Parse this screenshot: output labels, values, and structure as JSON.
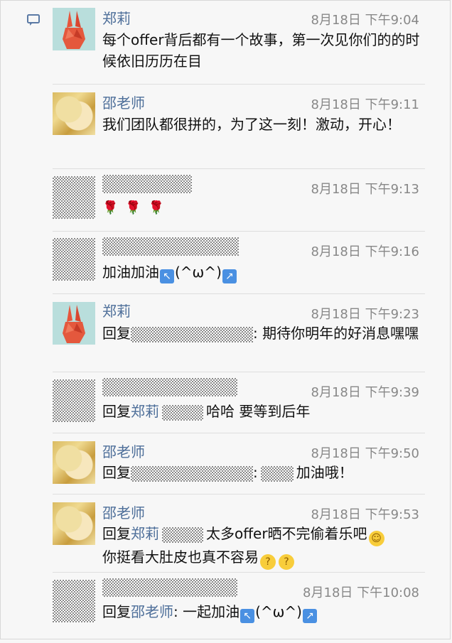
{
  "comments": [
    {
      "name": "郑莉",
      "avatar": "rabbit-avatar",
      "time": "8月18日 下午9:04",
      "text": "每个offer背后都有一个故事，第一次见你们的的时候依旧历历在目"
    },
    {
      "name": "邵老师",
      "avatar": "painting-avatar",
      "time": "8月18日 下午9:11",
      "text": "我们团队都很拼的，为了这一刻！激动，开心！"
    },
    {
      "name": "",
      "avatar": "masked-avatar",
      "time": "8月18日 下午9:13",
      "emoji": [
        "rose",
        "rose",
        "rose"
      ]
    },
    {
      "name": "",
      "avatar": "masked-avatar",
      "time": "8月18日 下午9:16",
      "text": "加油加油",
      "kaomoji": "(^ω^)"
    },
    {
      "name": "郑莉",
      "avatar": "rabbit-avatar",
      "time": "8月18日 下午9:23",
      "reply_prefix": "回复",
      "text_after": ": 期待你明年的好消息嘿嘿"
    },
    {
      "name": "",
      "avatar": "masked-avatar",
      "time": "8月18日 下午9:39",
      "reply_prefix": "回复",
      "reply_to": "郑莉",
      "text_after": "哈哈 要等到后年"
    },
    {
      "name": "邵老师",
      "avatar": "painting-avatar",
      "time": "8月18日 下午9:50",
      "reply_prefix": "回复",
      "separator": ":",
      "text_after": "加油哦！"
    },
    {
      "name": "邵老师",
      "avatar": "painting-avatar",
      "time": "8月18日 下午9:53",
      "reply_prefix": "回复",
      "reply_to": "郑莉",
      "text_after": "太多offer晒不完偷着乐吧",
      "line2": "你挺看大肚皮也真不容易"
    },
    {
      "name": "",
      "avatar": "masked-avatar",
      "time": "8月18日 下午10:08",
      "reply_prefix": "回复",
      "reply_to": "邵老师",
      "text_after": ": 一起加油",
      "kaomoji": "(^ω^)"
    }
  ]
}
